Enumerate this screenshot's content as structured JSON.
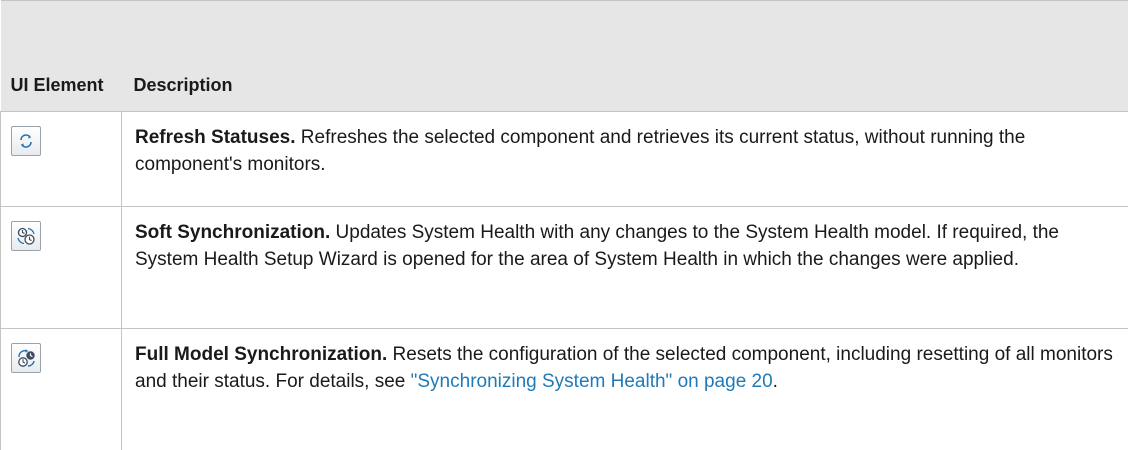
{
  "table": {
    "header": {
      "ui_element": "UI Element",
      "description": "Description"
    },
    "rows": [
      {
        "icon": "refresh-statuses-icon",
        "title": "Refresh Statuses.",
        "text": " Refreshes the selected component and retrieves its current status, without running the component's monitors."
      },
      {
        "icon": "soft-synchronization-icon",
        "title": "Soft Synchronization.",
        "text": " Updates System Health with any changes to the System Health model. If required, the System Health Setup Wizard is opened for the area of System Health in which the changes were applied."
      },
      {
        "icon": "full-model-synchronization-icon",
        "title": "Full Model Synchronization.",
        "text": " Resets the configuration of the selected component, including resetting of all monitors and their status. For details, see ",
        "link": "\"Synchronizing System Health\" on page 20",
        "text_end": "."
      }
    ]
  },
  "colors": {
    "header_background": "#e6e6e6",
    "grid_line": "#c4c4c4",
    "link": "#1f7ab8"
  }
}
